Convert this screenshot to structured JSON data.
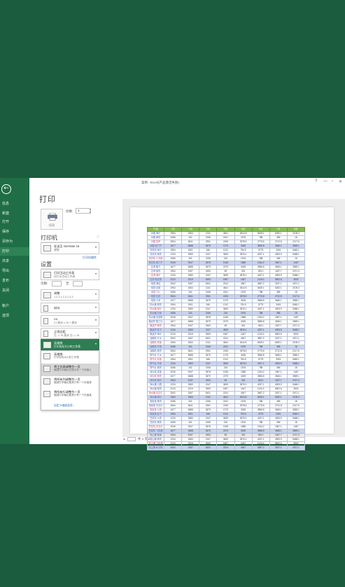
{
  "backstage": {
    "back_icon": "back-arrow-icon",
    "items": [
      {
        "label": "信息"
      },
      {
        "label": "新建"
      },
      {
        "label": "打开"
      },
      {
        "label": "保存"
      },
      {
        "label": "另存为"
      },
      {
        "label": "打印",
        "active": true
      },
      {
        "label": "共享"
      },
      {
        "label": "导出"
      },
      {
        "label": "发布"
      },
      {
        "label": "关闭"
      },
      {
        "label": "帐户"
      },
      {
        "label": "选项"
      }
    ]
  },
  "window": {
    "title": "案例 - Excel(产品激活失败)",
    "controls": [
      "?",
      "—",
      "▫",
      "✕"
    ]
  },
  "print": {
    "heading": "打印",
    "print_button_label": "打印",
    "copies_label": "份数:",
    "copies_value": "1"
  },
  "printer": {
    "heading": "打印机",
    "name": "发送至 OneNote 16",
    "status": "就绪",
    "properties_link": "打印机属性"
  },
  "settings": {
    "heading": "设置",
    "scope_main": "打印活动工作表",
    "scope_sub": "仅打印活动工作表",
    "pages_label": "页数:",
    "pages_to": "至",
    "collate_main": "调整",
    "collate_sub": "1,2,3    1,2,3    1,2,3",
    "orientation_main": "纵向",
    "paper_main": "A4",
    "paper_sub": "21 厘米 x 29.7 厘米",
    "margins_main": "正常边距",
    "margins_sub": "左: 1.78 厘米    右: 1.78",
    "scaling_main": "无缩放",
    "scaling_sub": "打印实际大小的工作表"
  },
  "scaling_popup": {
    "items": [
      {
        "main": "无缩放",
        "sub": "打印实际大小的工作表"
      },
      {
        "main": "将工作表调整为一页",
        "sub": "缩减打印输出以显示在一个页面上",
        "highlighted": true
      },
      {
        "main": "将所有列调整为一页",
        "sub": "缩减打印输出使其只有一个页面宽"
      },
      {
        "main": "将所有行调整为一页",
        "sub": "缩减打印输出使其只有一个页面高"
      }
    ],
    "custom_link": "自定义缩放选项..."
  },
  "preview": {
    "headers": [
      "产品",
      "1月",
      "2月",
      "3月",
      "4月",
      "5月",
      "6月",
      "7月",
      "8月"
    ],
    "rows": [
      [
        "冰箱 海尔",
        "1964",
        "1564",
        "1311",
        "4641",
        "4514.5",
        "5435.1",
        "6252.1",
        "2105.3"
      ],
      [
        "冰箱 美的",
        "3456",
        "341",
        "2156",
        "2161",
        "1576",
        "788",
        "365",
        "18"
      ],
      [
        "冰箱 容声",
        "3564",
        "3641",
        "2351",
        "2155",
        "2578.5",
        "2775.8",
        "2712.8",
        "2117.6"
      ],
      [
        "冰箱 西门子",
        "1677",
        "5688",
        "3679",
        "1275",
        "3435",
        "3556.8",
        "3645.1",
        "3569.1"
      ],
      [
        "洗衣机 海尔",
        "1964",
        "1501",
        "546",
        "1312",
        "794.5",
        "5775",
        "3491",
        "5460.1"
      ],
      [
        "洗衣机 美的",
        "1234",
        "3383",
        "1347",
        "3639",
        "3575.1",
        "4237.1",
        "4903.9",
        "5468.1"
      ],
      [
        "洗衣机 小天鹅",
        "3456",
        "341",
        "2156",
        "216",
        "1576",
        "788",
        "365",
        "18"
      ],
      [
        "洗衣机 西门子",
        "2045",
        "2947",
        "3578",
        "1345",
        "1588",
        "1334.2",
        "1567.1",
        "1467"
      ],
      [
        "空调 格力",
        "1677",
        "3688",
        "3679",
        "2275",
        "3435",
        "3556.8",
        "3645.1",
        "3569.1"
      ],
      [
        "空调 美的",
        "1964",
        "5157",
        "2453",
        "69",
        "315",
        "453.1",
        "1637.7",
        "2471.3"
      ],
      [
        "空调 海尔",
        "1234",
        "3383",
        "1347",
        "3639",
        "3575.1",
        "4237.1",
        "4903.9",
        "5468.1"
      ],
      [
        "空调 奥克斯",
        "3123",
        "2315",
        "3053",
        "1567",
        "1467",
        "1134.3",
        "5502.6",
        "3502"
      ],
      [
        "电视 海信",
        "2542",
        "2457",
        "5431",
        "2314",
        "4547",
        "3657.2",
        "3157.1",
        "4371.1"
      ],
      [
        "电视 创维",
        "1964",
        "1564",
        "1311",
        "4641",
        "4514.5",
        "5435.1",
        "6252.1",
        "2105.3"
      ],
      [
        "电视 TCL",
        "3456",
        "341",
        "2156",
        "2161",
        "1576",
        "788",
        "365",
        "18"
      ],
      [
        "电视 长虹",
        "3564",
        "3641",
        "2351",
        "2155",
        "2578.5",
        "2775.8",
        "2712.8",
        "2117.6"
      ],
      [
        "电视 小米",
        "1677",
        "5688",
        "3679",
        "1275",
        "3435",
        "3556.8",
        "3645.1",
        "3569.1"
      ],
      [
        "热水器 美的",
        "1964",
        "1501",
        "546",
        "1312",
        "794.5",
        "5775",
        "3491",
        "5460.1"
      ],
      [
        "热水器 海尔",
        "1234",
        "3383",
        "1347",
        "3639",
        "3575.1",
        "4237.1",
        "4903.9",
        "5468.1"
      ],
      [
        "热水器 万和",
        "3456",
        "341",
        "2156",
        "216",
        "1576",
        "788",
        "365",
        "18"
      ],
      [
        "热水器 史密斯",
        "2045",
        "2947",
        "3578",
        "1345",
        "1588",
        "1334.2",
        "1567.1",
        "1467"
      ],
      [
        "微波炉 格兰仕",
        "1677",
        "3688",
        "3679",
        "2275",
        "3435",
        "3556.8",
        "3645.1",
        "3569.1"
      ],
      [
        "微波炉 美的",
        "1964",
        "5157",
        "2453",
        "69",
        "315",
        "453.1",
        "1637.7",
        "2471.3"
      ],
      [
        "微波炉 松下",
        "1234",
        "3383",
        "1347",
        "3639",
        "3575.1",
        "4237.1",
        "4903.9",
        "5468.1"
      ],
      [
        "微波炉 海尔",
        "3123",
        "2315",
        "3053",
        "1567",
        "1467",
        "1134.3",
        "5502.6",
        "3502"
      ],
      [
        "油烟机 方太",
        "2542",
        "2457",
        "5431",
        "2314",
        "4547",
        "3657.2",
        "3157.1",
        "4371.1"
      ],
      [
        "油烟机 老板",
        "1964",
        "1564",
        "1311",
        "4641",
        "4514.5",
        "5435.1",
        "6252.1",
        "2105.3"
      ],
      [
        "油烟机 华帝",
        "3456",
        "341",
        "2156",
        "2161",
        "1576",
        "788",
        "365",
        "18"
      ],
      [
        "油烟机 美的",
        "3564",
        "3641",
        "2351",
        "2155",
        "2578.5",
        "2775.8",
        "2712.8",
        "2117.6"
      ],
      [
        "燃气灶 方太",
        "1677",
        "5688",
        "3679",
        "1275",
        "3435",
        "3556.8",
        "3645.1",
        "3569.1"
      ],
      [
        "燃气灶 老板",
        "1964",
        "1501",
        "546",
        "1312",
        "794.5",
        "5775",
        "3491",
        "5460.1"
      ],
      [
        "燃气灶 华帝",
        "1234",
        "3383",
        "1347",
        "3639",
        "3575.1",
        "4237.1",
        "4903.9",
        "5468.1"
      ],
      [
        "燃气灶 美的",
        "3456",
        "341",
        "2156",
        "216",
        "1576",
        "788",
        "365",
        "18"
      ],
      [
        "消毒柜 康宝",
        "2045",
        "2947",
        "3578",
        "1345",
        "1588",
        "1334.2",
        "1567.1",
        "1467"
      ],
      [
        "消毒柜 美的",
        "1677",
        "3688",
        "3679",
        "2275",
        "3435",
        "3556.8",
        "3645.1",
        "3569.1"
      ],
      [
        "消毒柜 海尔",
        "1964",
        "5157",
        "2453",
        "69",
        "315",
        "453.1",
        "1637.7",
        "2471.3"
      ],
      [
        "净水器 沁园",
        "1234",
        "3383",
        "1347",
        "3639",
        "3575.1",
        "4237.1",
        "4903.9",
        "5468.1"
      ],
      [
        "净水器 美的",
        "3123",
        "2315",
        "3053",
        "1567",
        "1467",
        "1134.3",
        "5502.6",
        "3502"
      ],
      [
        "净水器 安吉尔",
        "2542",
        "2457",
        "5431",
        "2314",
        "4547",
        "3657.2",
        "3157.1",
        "4371.1"
      ],
      [
        "净水器 海尔",
        "1964",
        "1564",
        "1311",
        "4641",
        "4514.5",
        "5435.1",
        "6252.1",
        "2105.3"
      ],
      [
        "电饭煲 美的",
        "3456",
        "341",
        "2156",
        "2161",
        "1576",
        "788",
        "365",
        "18"
      ],
      [
        "电饭煲 苏泊尔",
        "3564",
        "3641",
        "2351",
        "2155",
        "2578.5",
        "2775.8",
        "2712.8",
        "2117.6"
      ],
      [
        "电饭煲 九阳",
        "1677",
        "5688",
        "3679",
        "1275",
        "3435",
        "3556.8",
        "3645.1",
        "3569.1"
      ],
      [
        "电饭煲 松下",
        "1964",
        "1501",
        "546",
        "1312",
        "794.5",
        "5775",
        "3491",
        "5460.1"
      ],
      [
        "豆浆机 九阳",
        "1234",
        "3383",
        "1347",
        "3639",
        "3575.1",
        "4237.1",
        "4903.9",
        "5468.1"
      ],
      [
        "豆浆机 美的",
        "3456",
        "341",
        "2156",
        "216",
        "1576",
        "788",
        "365",
        "18"
      ],
      [
        "豆浆机 苏泊尔",
        "2045",
        "2947",
        "3578",
        "1345",
        "1588",
        "1334.2",
        "1567.1",
        "1467"
      ],
      [
        "豆浆机 飞利浦",
        "1677",
        "3688",
        "3679",
        "2275",
        "3435",
        "3556.8",
        "3645.1",
        "3569.1"
      ],
      [
        "吸尘器 戴森",
        "1964",
        "5157",
        "2453",
        "69",
        "315",
        "453.1",
        "1637.7",
        "2471.3"
      ],
      [
        "吸尘器 美的",
        "1234",
        "3383",
        "1347",
        "3639",
        "3575.1",
        "4237.1",
        "4903.9",
        "5468.1"
      ],
      [
        "吸尘器 飞利浦",
        "3123",
        "2315",
        "3053",
        "1567",
        "1467",
        "1134.3",
        "5502.6",
        "3502"
      ],
      [
        "吸尘器 科沃斯",
        "2542",
        "2457",
        "5431",
        "2314",
        "4547",
        "3657.2",
        "3157.1",
        "4371.1"
      ]
    ],
    "nav": {
      "prev": "◂",
      "current": "1",
      "total_text": "共 4 页",
      "next": "▸"
    }
  }
}
